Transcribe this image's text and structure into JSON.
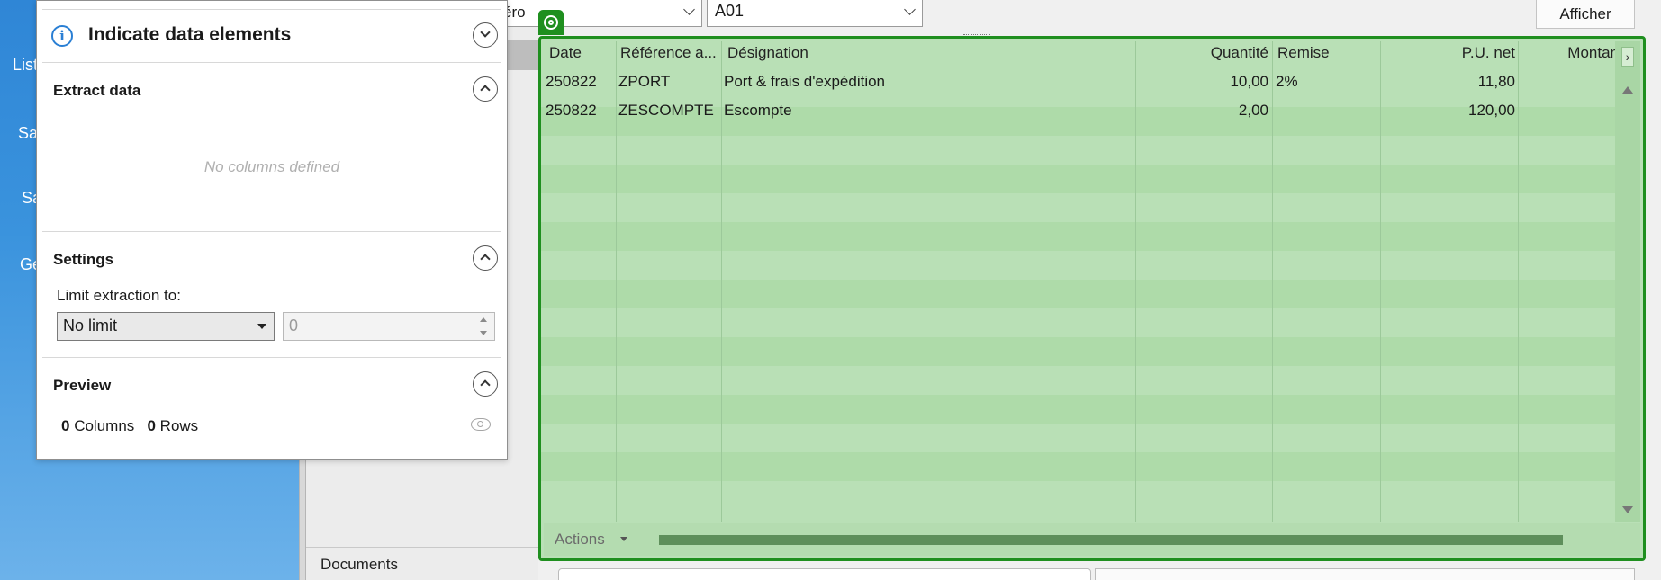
{
  "background": {
    "nav_items": [
      "List",
      "Sa",
      "Sa",
      "Ge"
    ],
    "numero_field": "éro",
    "reference_field": "A01",
    "afficher_button": "Afficher",
    "documents_label": "Documents"
  },
  "panel": {
    "indicate_title": "Indicate data elements",
    "extract_title": "Extract data",
    "no_columns": "No columns defined",
    "settings_title": "Settings",
    "limit_label": "Limit extraction to:",
    "limit_select": "No limit",
    "limit_number": "0",
    "preview_title": "Preview",
    "columns_count": "0",
    "columns_label": "Columns",
    "rows_count": "0",
    "rows_label": "Rows"
  },
  "grid": {
    "headers": [
      "Date",
      "Référence a...",
      "Désignation",
      "Quantité",
      "Remise",
      "P.U. net",
      "Montan"
    ],
    "rows": [
      [
        "250822",
        "ZPORT",
        "Port & frais d'expédition",
        "10,00",
        "2%",
        "11,80",
        ""
      ],
      [
        "250822",
        "ZESCOMPTE",
        "Escompte",
        "2,00",
        "",
        "120,00",
        ""
      ]
    ],
    "actions_label": "Actions"
  },
  "colors": {
    "highlight_border": "#1f8f1f",
    "highlight_fill": "#b9e0b6",
    "info_blue": "#2a7fd4"
  }
}
